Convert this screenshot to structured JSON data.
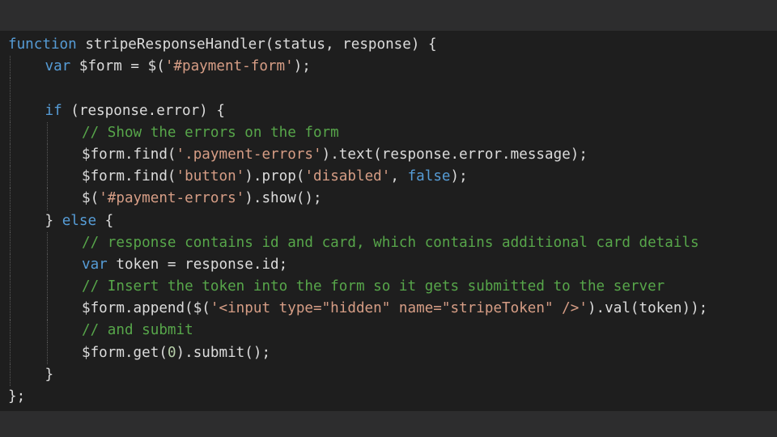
{
  "editor": {
    "lines": [
      {
        "indent": 0,
        "tokens": [
          {
            "t": "function",
            "k": "keyword"
          },
          {
            "t": " stripeResponseHandler",
            "k": "ident"
          },
          {
            "t": "(status, response) {",
            "k": "punct"
          }
        ]
      },
      {
        "indent": 1,
        "tokens": [
          {
            "t": "var",
            "k": "keyword"
          },
          {
            "t": " $form = $(",
            "k": "ident"
          },
          {
            "t": "'#payment-form'",
            "k": "string"
          },
          {
            "t": ");",
            "k": "punct"
          }
        ]
      },
      {
        "indent": 1,
        "tokens": []
      },
      {
        "indent": 1,
        "tokens": [
          {
            "t": "if",
            "k": "keyword"
          },
          {
            "t": " (response.error) {",
            "k": "ident"
          }
        ]
      },
      {
        "indent": 2,
        "tokens": [
          {
            "t": "// Show the errors on the form",
            "k": "comment"
          }
        ]
      },
      {
        "indent": 2,
        "tokens": [
          {
            "t": "$form.find(",
            "k": "ident"
          },
          {
            "t": "'.payment-errors'",
            "k": "string"
          },
          {
            "t": ").text(response.error.message);",
            "k": "ident"
          }
        ]
      },
      {
        "indent": 2,
        "tokens": [
          {
            "t": "$form.find(",
            "k": "ident"
          },
          {
            "t": "'button'",
            "k": "string"
          },
          {
            "t": ").prop(",
            "k": "ident"
          },
          {
            "t": "'disabled'",
            "k": "string"
          },
          {
            "t": ", ",
            "k": "punct"
          },
          {
            "t": "false",
            "k": "keyword"
          },
          {
            "t": ");",
            "k": "punct"
          }
        ]
      },
      {
        "indent": 2,
        "tokens": [
          {
            "t": "$(",
            "k": "ident"
          },
          {
            "t": "'#payment-errors'",
            "k": "string"
          },
          {
            "t": ").show();",
            "k": "ident"
          }
        ]
      },
      {
        "indent": 1,
        "tokens": [
          {
            "t": "} ",
            "k": "punct"
          },
          {
            "t": "else",
            "k": "keyword"
          },
          {
            "t": " {",
            "k": "punct"
          }
        ]
      },
      {
        "indent": 2,
        "tokens": [
          {
            "t": "// response contains id and card, which contains additional card details",
            "k": "comment"
          }
        ]
      },
      {
        "indent": 2,
        "tokens": [
          {
            "t": "var",
            "k": "keyword"
          },
          {
            "t": " token = response.id;",
            "k": "ident"
          }
        ]
      },
      {
        "indent": 2,
        "tokens": [
          {
            "t": "// Insert the token into the form so it gets submitted to the server",
            "k": "comment"
          }
        ]
      },
      {
        "indent": 2,
        "tokens": [
          {
            "t": "$form.append($(",
            "k": "ident"
          },
          {
            "t": "'<input type=\"hidden\" name=\"stripeToken\" />'",
            "k": "string"
          },
          {
            "t": ").val(token));",
            "k": "ident"
          }
        ]
      },
      {
        "indent": 2,
        "tokens": [
          {
            "t": "// and submit",
            "k": "comment"
          }
        ]
      },
      {
        "indent": 2,
        "tokens": [
          {
            "t": "$form.get(",
            "k": "ident"
          },
          {
            "t": "0",
            "k": "number"
          },
          {
            "t": ").submit();",
            "k": "ident"
          }
        ]
      },
      {
        "indent": 1,
        "tokens": [
          {
            "t": "}",
            "k": "punct"
          }
        ]
      },
      {
        "indent": 0,
        "tokens": [
          {
            "t": "};",
            "k": "punct"
          }
        ]
      }
    ]
  },
  "theme": {
    "background": "#1e1e1e",
    "keyword": "#569cd6",
    "string": "#d69d85",
    "comment": "#57a64a",
    "identifier": "#dcdcdc"
  }
}
